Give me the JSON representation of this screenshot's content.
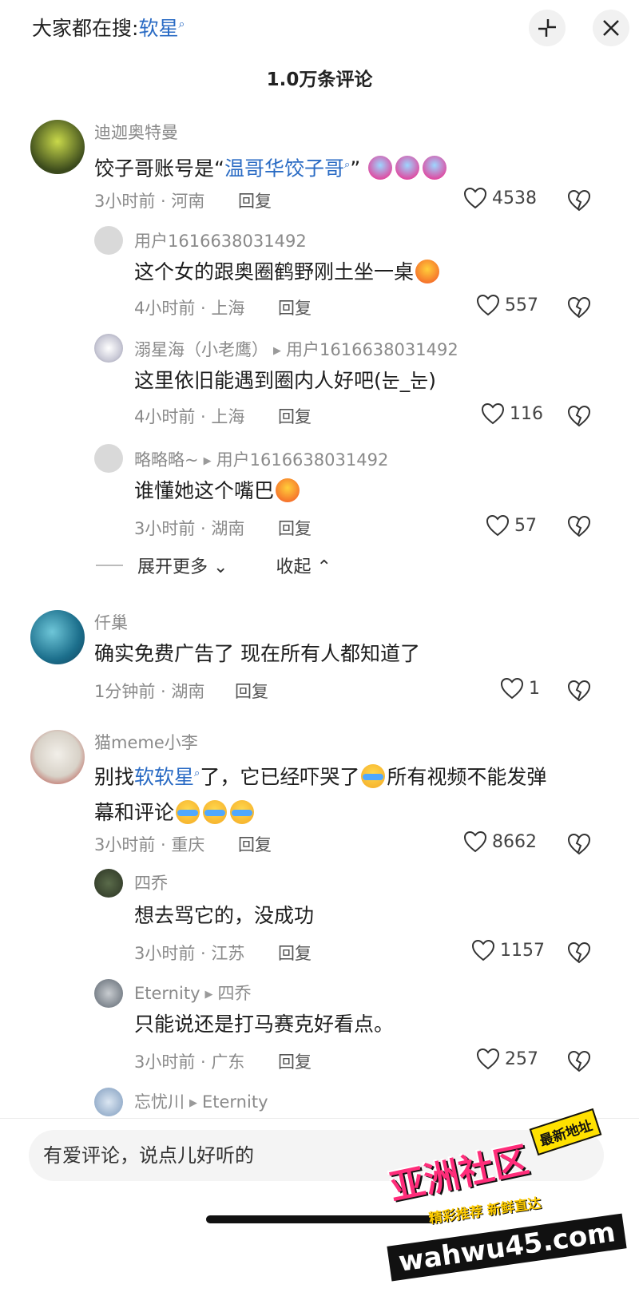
{
  "header": {
    "search_prefix": "大家都在搜:",
    "search_keyword": "软星",
    "comment_count": "1.0万条评论"
  },
  "comments": [
    {
      "username": "迪迦奥特曼",
      "text_before": "饺子哥账号是“",
      "keyword": "温哥华饺子哥",
      "text_after": "”",
      "time_location": "3小时前 · 河南",
      "reply_label": "回复",
      "likes": "4538"
    },
    {
      "username": "用户1616638031492",
      "text": "这个女的跟奥圈鹤野刚土坐一桌",
      "time_location": "4小时前 · 上海",
      "reply_label": "回复",
      "likes": "557"
    },
    {
      "username": "溺星海（小老鹰）",
      "reply_to": "用户1616638031492",
      "text": "这里依旧能遇到圈内人好吧(눈_눈)",
      "time_location": "4小时前 · 上海",
      "reply_label": "回复",
      "likes": "116"
    },
    {
      "username": "略略略~",
      "reply_to": "用户1616638031492",
      "text": "谁懂她这个嘴巴",
      "time_location": "3小时前 · 湖南",
      "reply_label": "回复",
      "likes": "57"
    },
    {
      "username": "仟巢",
      "text": "确实免费广告了  现在所有人都知道了",
      "time_location": "1分钟前 · 湖南",
      "reply_label": "回复",
      "likes": "1"
    },
    {
      "username": "猫meme小李",
      "text_before": "别找",
      "keyword": "软软星",
      "text_after": "了，它已经吓哭了",
      "text_line1_end": "所有视频不能发弹",
      "text_line2": "幕和评论",
      "time_location": "3小时前 · 重庆",
      "reply_label": "回复",
      "likes": "8662"
    },
    {
      "username": "四乔",
      "text": "想去骂它的，没成功",
      "time_location": "3小时前 · 江苏",
      "reply_label": "回复",
      "likes": "1157"
    },
    {
      "username": "Eternity",
      "reply_to": "四乔",
      "text": "只能说还是打马赛克好看点。",
      "time_location": "3小时前 · 广东",
      "reply_label": "回复",
      "likes": "257"
    },
    {
      "username": "忘忧川",
      "reply_to": "Eternity"
    }
  ],
  "thread_controls": {
    "expand_more": "展开更多",
    "collapse": "收起"
  },
  "input": {
    "placeholder": "有爱评论，说点儿好听的"
  },
  "watermark": {
    "main": "亚洲社区",
    "badge": "最新地址",
    "sub": "精彩推荐  新鲜直达",
    "url": "wahwu45.com"
  },
  "icons": {
    "like": "heart-outline-icon",
    "dislike": "broken-heart-icon",
    "search_hint": "magnifier-icon",
    "collapse_panel": "collapse-icon",
    "close": "close-icon"
  }
}
